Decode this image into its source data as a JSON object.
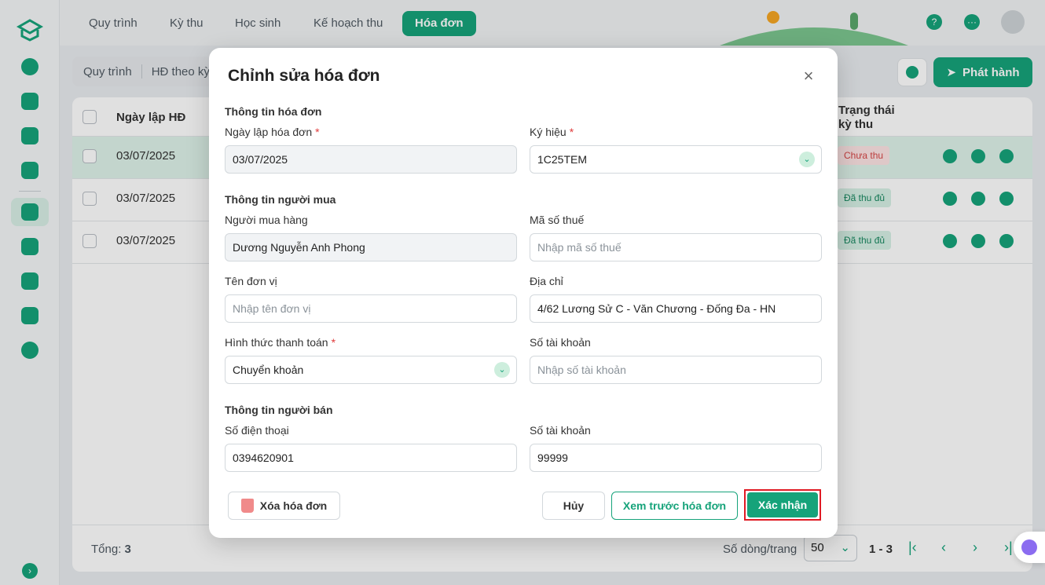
{
  "topnav": {
    "tabs": [
      {
        "label": "Quy trình"
      },
      {
        "label": "Kỳ thu"
      },
      {
        "label": "Học sinh"
      },
      {
        "label": "Kế hoạch thu"
      },
      {
        "label": "Hóa đơn"
      }
    ],
    "help_label": "?",
    "more_label": "···"
  },
  "subbar": {
    "seg1": "Quy trình",
    "seg2": "HĐ theo kỳ",
    "publish_label": "Phát hành"
  },
  "table": {
    "headers": {
      "date": "Ngày lập HĐ",
      "status": "Trạng thái kỳ thu"
    },
    "rows": [
      {
        "date": "03/07/2025",
        "status": "Chưa thu"
      },
      {
        "date": "03/07/2025",
        "status": "Đã thu đủ"
      },
      {
        "date": "03/07/2025",
        "status": "Đã thu đủ"
      }
    ],
    "footer": {
      "total_label": "Tổng:",
      "total_value": "3",
      "rows_per_page_label": "Số dòng/trang",
      "rows_per_page_value": "50",
      "range": "1 - 3"
    }
  },
  "modal": {
    "title": "Chỉnh sửa hóa đơn",
    "sections": {
      "invoice": "Thông tin hóa đơn",
      "buyer": "Thông tin người mua",
      "seller": "Thông tin người bán"
    },
    "fields": {
      "invoice_date": {
        "label": "Ngày lập hóa đơn",
        "value": "03/07/2025"
      },
      "symbol": {
        "label": "Ký hiệu",
        "value": "1C25TEM"
      },
      "buyer_name": {
        "label": "Người mua hàng",
        "value": "Dương Nguyễn Anh Phong"
      },
      "tax_code": {
        "label": "Mã số thuế",
        "placeholder": "Nhập mã số thuế"
      },
      "unit_name": {
        "label": "Tên đơn vị",
        "placeholder": "Nhập tên đơn vị"
      },
      "address": {
        "label": "Địa chỉ",
        "value": "4/62 Lương Sử C - Văn Chương - Đống Đa - HN"
      },
      "payment_method": {
        "label": "Hình thức thanh toán",
        "value": "Chuyển khoản"
      },
      "buyer_account": {
        "label": "Số tài khoản",
        "placeholder": "Nhập số tài khoản"
      },
      "seller_phone": {
        "label": "Số điện thoại",
        "value": "0394620901"
      },
      "seller_account": {
        "label": "Số tài khoản",
        "value": "99999"
      }
    },
    "required_mark": "*",
    "buttons": {
      "delete": "Xóa hóa đơn",
      "cancel": "Hủy",
      "preview": "Xem trước hóa đơn",
      "confirm": "Xác nhận"
    }
  },
  "colors": {
    "accent": "#16a37a",
    "highlight": "#e01b24"
  }
}
